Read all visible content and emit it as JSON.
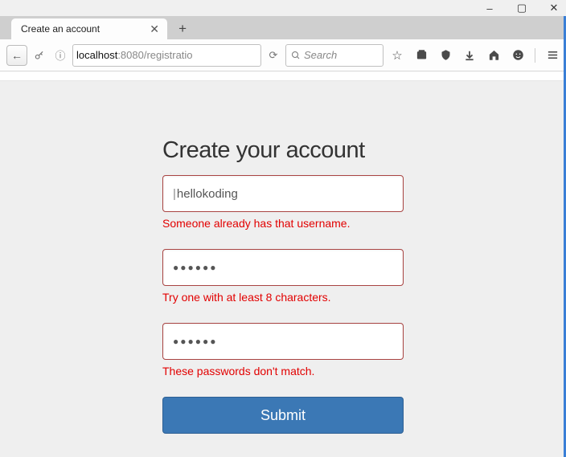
{
  "window": {
    "controls": {
      "minimize": "–",
      "maximize": "▢",
      "close": "✕"
    }
  },
  "tab": {
    "title": "Create an account",
    "close": "✕",
    "new": "+"
  },
  "toolbar": {
    "back": "←",
    "info": "ⓘ",
    "reload_glyph": "⟳",
    "url_host": "localhost",
    "url_path": ":8080/registratio",
    "search_placeholder": "Search",
    "icons": {
      "bookmark": "bookmark-star-icon",
      "library": "library-icon",
      "pocket": "pocket-icon",
      "downloads": "downloads-icon",
      "home": "home-icon",
      "smiley": "feedback-icon",
      "menu": "hamburger-icon"
    }
  },
  "form": {
    "heading": "Create your account",
    "username_value": "hellokoding",
    "username_error": "Someone already has that username.",
    "password_dots": "●●●●●●",
    "password_error": "Try one with at least 8 characters.",
    "confirm_dots": "●●●●●●",
    "confirm_error": "These passwords don't match.",
    "submit_label": "Submit"
  }
}
